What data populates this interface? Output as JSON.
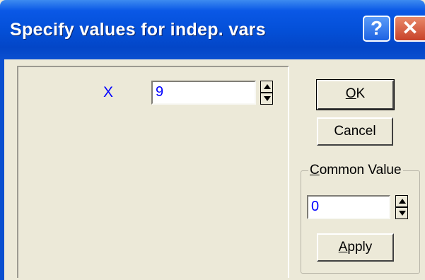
{
  "window": {
    "title": "Specify values for indep. vars",
    "help_label": "?",
    "close_label": "✕"
  },
  "variables": [
    {
      "label": "X",
      "value": "9"
    }
  ],
  "buttons": {
    "ok_mnemonic": "O",
    "ok_rest": "K",
    "cancel": "Cancel",
    "apply_mnemonic": "A",
    "apply_rest": "pply"
  },
  "common_value": {
    "legend_mnemonic": "C",
    "legend_rest": "ommon Value",
    "value": "0"
  },
  "colors": {
    "titlebar": "#0450d8",
    "value_text": "#0000ff",
    "dialog_bg": "#ece9d8"
  }
}
